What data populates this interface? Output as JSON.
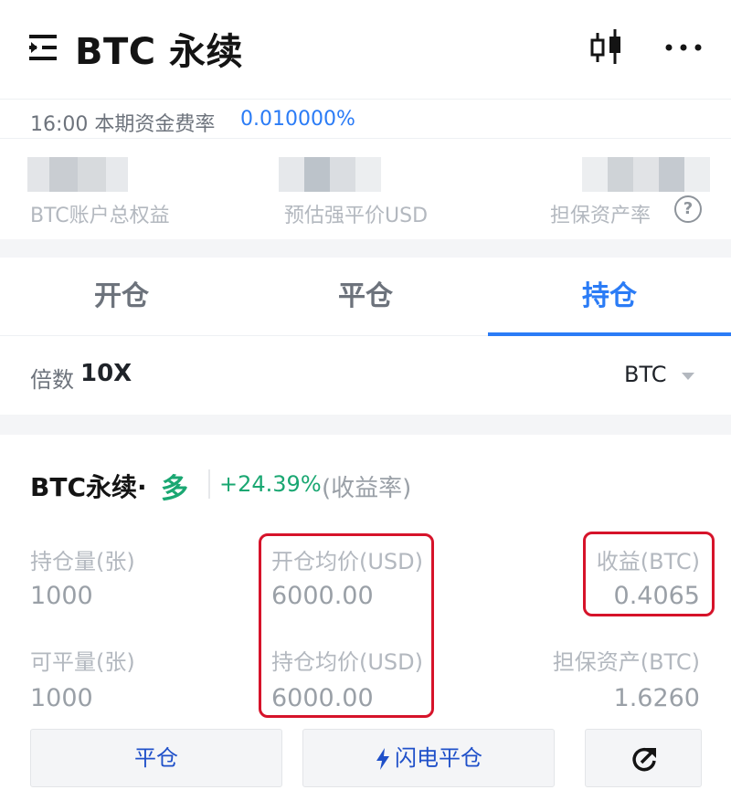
{
  "header": {
    "title": "BTC 永续",
    "menu_icon": "menu-icon",
    "chart_icon": "candlestick-icon",
    "more_icon": "more-icon"
  },
  "funding": {
    "time_label": "16:00 本期资金费率",
    "rate": "0.010000%"
  },
  "stats": {
    "equity_label": "BTC账户总权益",
    "liq_price_label": "预估强平价USD",
    "margin_ratio_label": "担保资产率",
    "help_glyph": "?"
  },
  "tabs": [
    {
      "label": "开仓",
      "active": false
    },
    {
      "label": "平仓",
      "active": false
    },
    {
      "label": "持仓",
      "active": true
    }
  ],
  "leverage": {
    "label": "倍数",
    "value": "10X",
    "coin": "BTC"
  },
  "position": {
    "title": "BTC永续·",
    "side": "多",
    "pnl_rate": "+24.39%",
    "pnl_rate_label": "(收益率)",
    "qty_label": "持仓量(张)",
    "qty_value": "1000",
    "avg_open_label": "开仓均价(USD)",
    "avg_open_value": "6000.00",
    "profit_label": "收益(BTC)",
    "profit_value": "0.4065",
    "closeable_label": "可平量(张)",
    "closeable_value": "1000",
    "avg_hold_label": "持仓均价(USD)",
    "avg_hold_value": "6000.00",
    "margin_label": "担保资产(BTC)",
    "margin_value": "1.6260"
  },
  "actions": {
    "close_label": "平仓",
    "flash_close_label": "闪电平仓"
  },
  "colors": {
    "accent": "#2b7cf6",
    "profit_green": "#1aa772",
    "highlight_red": "#d6132a",
    "button_text": "#1f50c9"
  }
}
